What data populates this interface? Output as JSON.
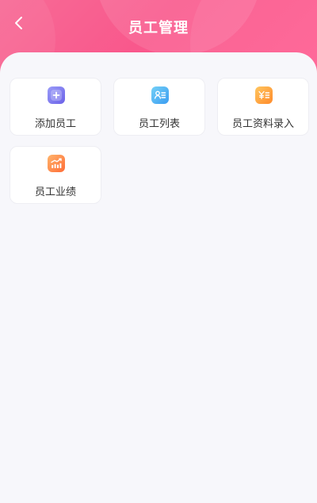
{
  "header": {
    "title": "员工管理",
    "back_icon": "chevron-left-icon",
    "gradient": [
      "#f76b96",
      "#ff5f93"
    ]
  },
  "menu": {
    "items": [
      {
        "label": "添加员工",
        "icon": "add-square-icon",
        "color": [
          "#8e92f7",
          "#6a64e8"
        ]
      },
      {
        "label": "员工列表",
        "icon": "contact-card-icon",
        "color": [
          "#6cc8f6",
          "#3b9df0"
        ]
      },
      {
        "label": "员工资料录入",
        "icon": "yen-list-icon",
        "color": [
          "#ffc35a",
          "#ff8a2b"
        ]
      },
      {
        "label": "员工业绩",
        "icon": "bar-chart-up-icon",
        "color": [
          "#ffb36b",
          "#ff6f3a"
        ]
      }
    ]
  }
}
